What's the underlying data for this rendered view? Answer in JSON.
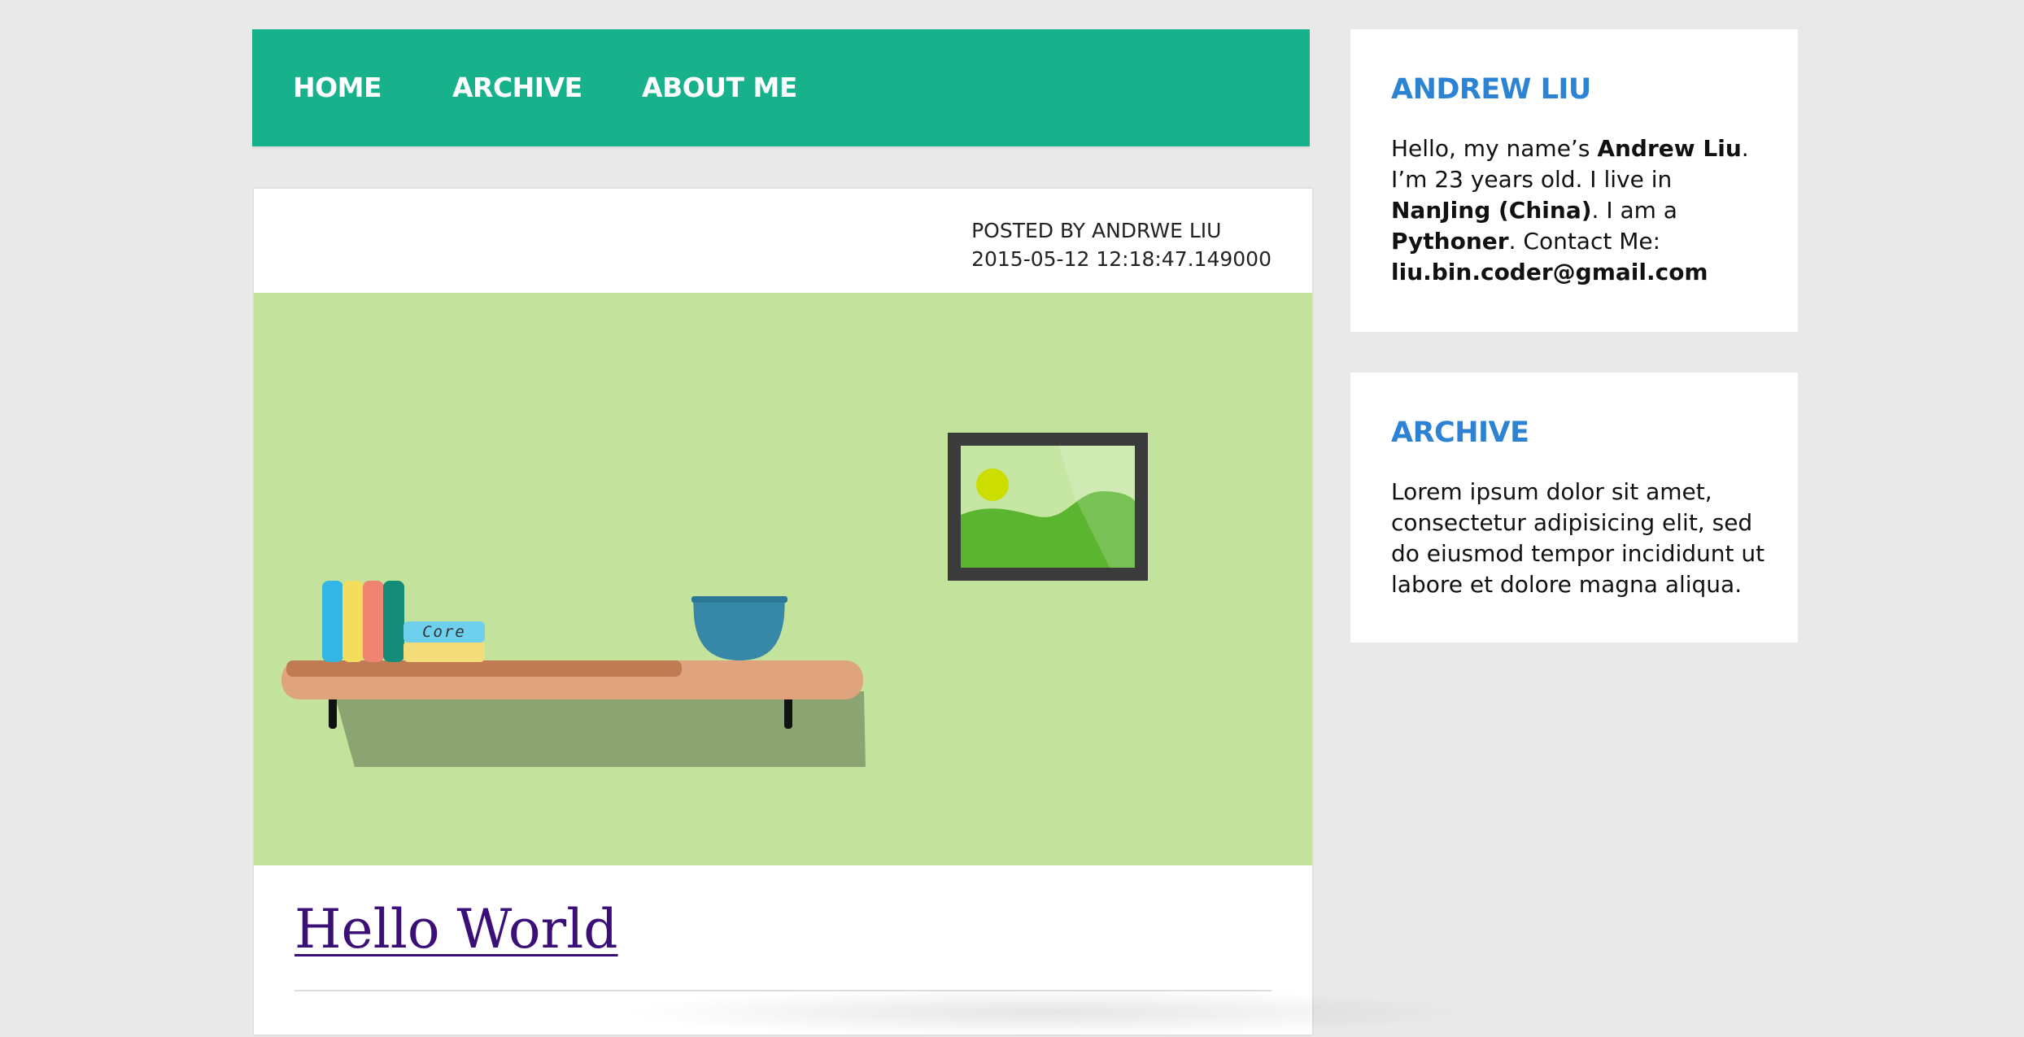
{
  "nav": {
    "items": [
      {
        "label": "HOME"
      },
      {
        "label": "ARCHIVE"
      },
      {
        "label": "ABOUT ME"
      }
    ],
    "color": "#17b28b"
  },
  "post": {
    "author_line": "POSTED BY ANDRWE LIU",
    "timestamp": "2015-05-12 12:18:47.149000",
    "title": "Hello World",
    "hero_label": "Core",
    "hero_color": "#c3e29c"
  },
  "sidebar": {
    "about": {
      "title": "ANDREW LIU",
      "t1": "Hello, my name’s ",
      "name": "Andrew Liu",
      "t2": ". I’m 23 years old. I live in ",
      "city": "NanJing (China)",
      "t3": ". I am a ",
      "role": "Pythoner",
      "t4": ". Contact Me: ",
      "email": "liu.bin.coder@gmail.com"
    },
    "archive": {
      "title": "ARCHIVE",
      "text": "Lorem ipsum dolor sit amet, consectetur adipisicing elit, sed do eiusmod tempor incididunt ut labore et dolore magna aliqua."
    },
    "accent_color": "#2c82d3"
  }
}
